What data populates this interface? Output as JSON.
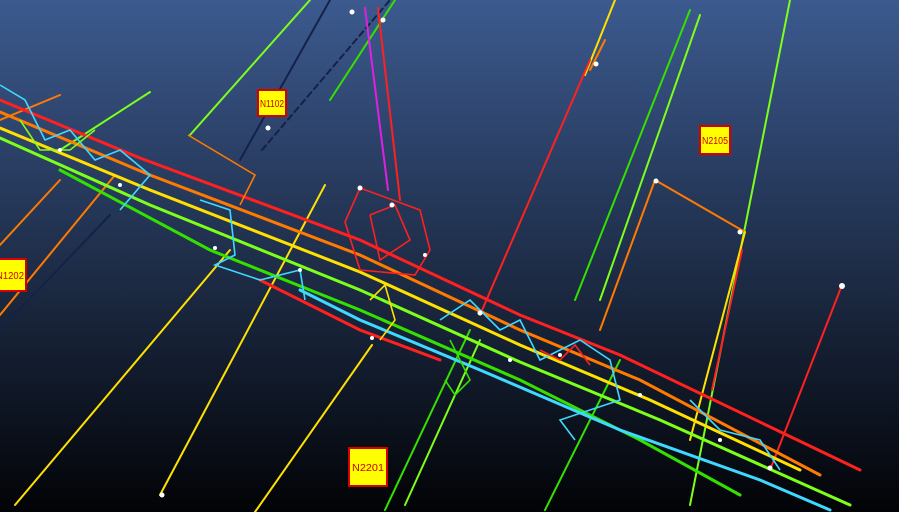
{
  "viewport": {
    "background_top": "#3c5a8f",
    "background_bottom": "#020306"
  },
  "labels": {
    "n1102": "N1102",
    "n2105": "N2105",
    "n1202": "N1202",
    "n2201": "N2201"
  },
  "label_style": {
    "fill": "#ffff00",
    "border": "#d40000",
    "text": "#cc0000"
  },
  "line_colors": {
    "red": "#ff2020",
    "orange": "#ff7a00",
    "yellow": "#ffe100",
    "lime": "#7cff1a",
    "green": "#34e000",
    "cyan": "#3fd8ff",
    "magenta": "#e020e0",
    "navy": "#14224a",
    "node": "#ffffff"
  }
}
